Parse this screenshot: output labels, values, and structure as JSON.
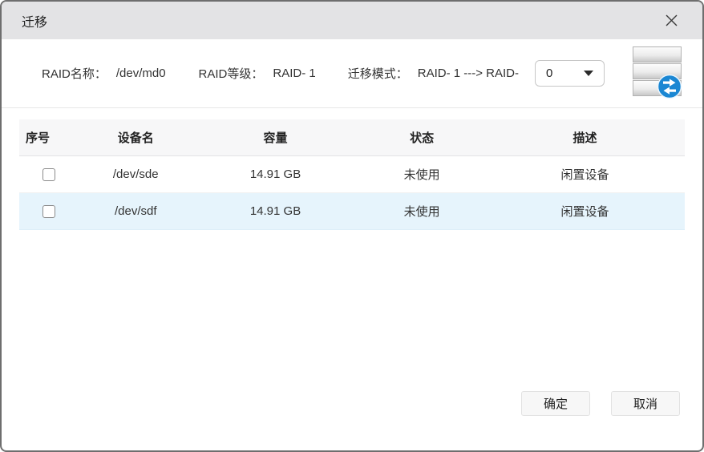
{
  "dialog": {
    "title": "迁移"
  },
  "header": {
    "raid_name_label": "RAID名称：",
    "raid_name_value": "/dev/md0",
    "raid_level_label": "RAID等级：",
    "raid_level_value": "RAID- 1",
    "migration_mode_label": "迁移模式：",
    "migration_mode_value": "RAID- 1 ---> RAID-",
    "mode_select": {
      "selected_value": "0"
    }
  },
  "icons": {
    "close": "x-cross",
    "dropdown_caret": "triangle-down",
    "disk_badge": "transfer-arrows"
  },
  "table": {
    "headers": [
      "序号",
      "设备名",
      "容量",
      "状态",
      "描述"
    ],
    "rows": [
      {
        "device": "/dev/sde",
        "capacity": "14.91 GB",
        "status": "未使用",
        "description": "闲置设备",
        "checked": false,
        "highlighted": false
      },
      {
        "device": "/dev/sdf",
        "capacity": "14.91 GB",
        "status": "未使用",
        "description": "闲置设备",
        "checked": false,
        "highlighted": true
      }
    ]
  },
  "footer": {
    "ok_label": "确定",
    "cancel_label": "取消"
  },
  "colors": {
    "titlebar_bg": "#e3e3e5",
    "table_header_bg": "#f7f7f8",
    "row_highlight_bg": "#e6f4fc",
    "badge_blue": "#1b87d3",
    "dialog_border": "#6e6e6e"
  }
}
